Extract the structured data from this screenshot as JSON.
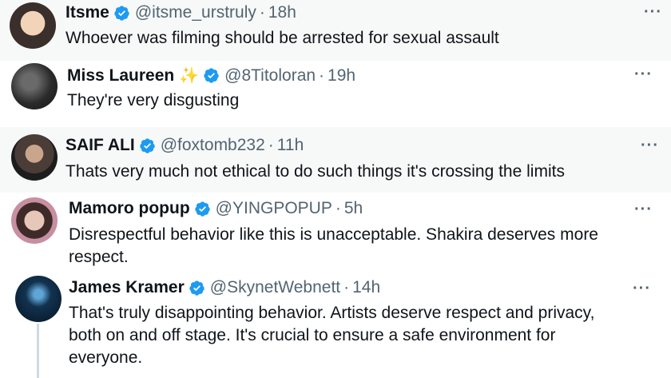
{
  "colors": {
    "verified": "#1d9bf0",
    "text": "#0f1419",
    "secondary": "#536471"
  },
  "replies": [
    {
      "name": "Itsme",
      "handle": "@itsme_urstruly",
      "separator": "·",
      "time": "18h",
      "text": "Whoever was filming should be arrested for sexual assault",
      "more": "···"
    },
    {
      "name": "Miss Laureen",
      "name_emoji": "✨",
      "handle": "@8Titoloran",
      "separator": "·",
      "time": "19h",
      "text": "They're very disgusting",
      "more": "···"
    },
    {
      "name": "SAIF ALI",
      "handle": "@foxtomb232",
      "separator": "·",
      "time": "11h",
      "text": "Thats very much not ethical to do such things it's crossing the limits",
      "more": "···"
    },
    {
      "name": "Mamoro popup",
      "handle": "@YINGPOPUP",
      "separator": "·",
      "time": "5h",
      "text_lines": [
        "Disrespectful behavior like this is unacceptable. Shakira deserves more",
        "respect."
      ],
      "more": "···"
    },
    {
      "name": "James Kramer",
      "handle": "@SkynetWebnett",
      "separator": "·",
      "time": "14h",
      "text_lines": [
        "That's truly disappointing behavior. Artists deserve respect and privacy,",
        "both on and off stage. It's crucial to ensure a safe environment for",
        "everyone."
      ],
      "more": "···"
    }
  ]
}
